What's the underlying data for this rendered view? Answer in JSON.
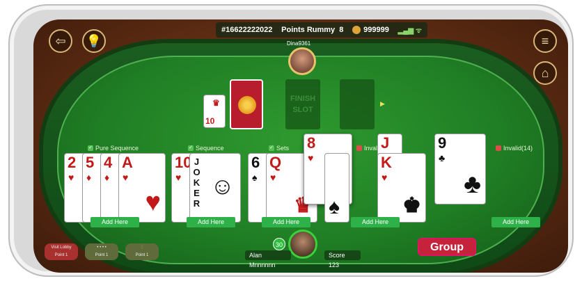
{
  "topbar": {
    "table_id": "#16622222022",
    "game": "Points Rummy",
    "game_count": "8",
    "chips": "999999"
  },
  "opponent": {
    "name": "Dina9361"
  },
  "center": {
    "open_card_rank": "10",
    "finish_slot": "FINISH SLOT"
  },
  "groups": [
    {
      "label": "Pure Sequence",
      "status": "valid",
      "add_label": "Add Here"
    },
    {
      "label": "Sequence",
      "status": "valid",
      "add_label": "Add Here"
    },
    {
      "label": "Sets",
      "status": "valid",
      "add_label": "Add Here"
    },
    {
      "label": "Invalid(14)",
      "status": "invalid",
      "add_label": "Add Here"
    },
    {
      "label": "Invalid(14)",
      "status": "invalid",
      "add_label": "Add Here"
    }
  ],
  "cards": {
    "g1": [
      "2",
      "5",
      "4",
      "A"
    ],
    "g2": [
      "10",
      "JOKER"
    ],
    "g3": [
      "6",
      "Q"
    ],
    "floating": "8",
    "g4": [
      "J",
      "K"
    ],
    "g5": [
      "9"
    ]
  },
  "player": {
    "name": "Alan Mnnnnnn",
    "score": "Score 123",
    "timer": "30"
  },
  "actions": {
    "group_label": "Group"
  },
  "pills": [
    {
      "top": "Visit Lobby",
      "bottom": "Point 1"
    },
    {
      "top": "",
      "bottom": "Point 1"
    },
    {
      "top": "",
      "bottom": "Point 1"
    }
  ],
  "colors": {
    "felt": "#1f7d24",
    "accent": "#c5233b",
    "add": "#2fb14a"
  }
}
